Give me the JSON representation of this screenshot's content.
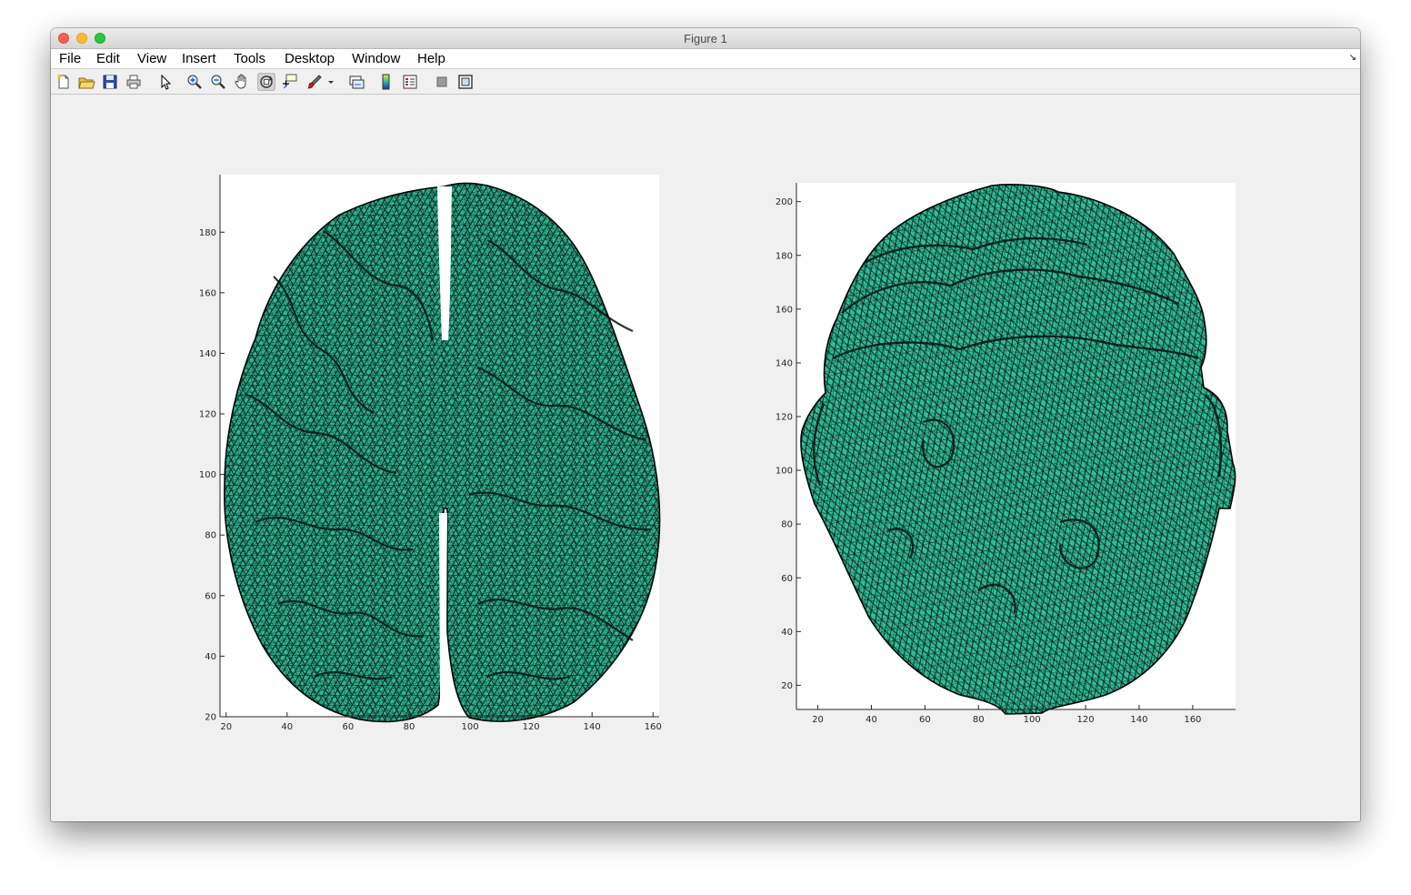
{
  "window": {
    "title": "Figure 1"
  },
  "menu": [
    "File",
    "Edit",
    "View",
    "Insert",
    "Tools",
    "Desktop",
    "Window",
    "Help"
  ],
  "menu_corner_icon": "dock-arrow-icon",
  "toolbar": [
    "new-figure-icon",
    "open-file-icon",
    "save-icon",
    "print-icon",
    "edit-plot-arrow-icon",
    "zoom-in-icon",
    "zoom-out-icon",
    "pan-hand-icon",
    "rotate-3d-icon",
    "data-cursor-icon",
    "brush-icon",
    "brush-dropdown-icon",
    "link-plot-icon",
    "insert-colorbar-icon",
    "insert-legend-icon",
    "hide-plot-tools-icon",
    "show-plot-tools-icon"
  ],
  "colors": {
    "surface_face": "#2eb894",
    "mesh_edge": "#000000",
    "axes_background": "#ffffff",
    "figure_background": "#f0f0f0"
  },
  "chart_data": [
    {
      "type": "3d-surface-mesh",
      "subject": "cortical surface (brain), top view",
      "xlim": [
        18,
        162
      ],
      "ylim": [
        20,
        199
      ],
      "x_ticks": [
        "20",
        "40",
        "60",
        "80",
        "100",
        "120",
        "140",
        "160"
      ],
      "y_ticks": [
        "20",
        "40",
        "60",
        "80",
        "100",
        "120",
        "140",
        "160",
        "180"
      ],
      "x_tick_values": [
        20,
        40,
        60,
        80,
        100,
        120,
        140,
        160
      ],
      "y_tick_values": [
        20,
        40,
        60,
        80,
        100,
        120,
        140,
        160,
        180
      ],
      "face_color": "#2eb894",
      "edge_color": "#000000"
    },
    {
      "type": "3d-surface-mesh",
      "subject": "scalp surface (head), top view",
      "xlim": [
        12,
        176
      ],
      "ylim": [
        11,
        207
      ],
      "x_ticks": [
        "20",
        "40",
        "60",
        "80",
        "100",
        "120",
        "140",
        "160"
      ],
      "y_ticks": [
        "20",
        "40",
        "60",
        "80",
        "100",
        "120",
        "140",
        "160",
        "180",
        "200"
      ],
      "x_tick_values": [
        20,
        40,
        60,
        80,
        100,
        120,
        140,
        160
      ],
      "y_tick_values": [
        20,
        40,
        60,
        80,
        100,
        120,
        140,
        160,
        180,
        200
      ],
      "face_color": "#2eb894",
      "edge_color": "#000000"
    }
  ]
}
